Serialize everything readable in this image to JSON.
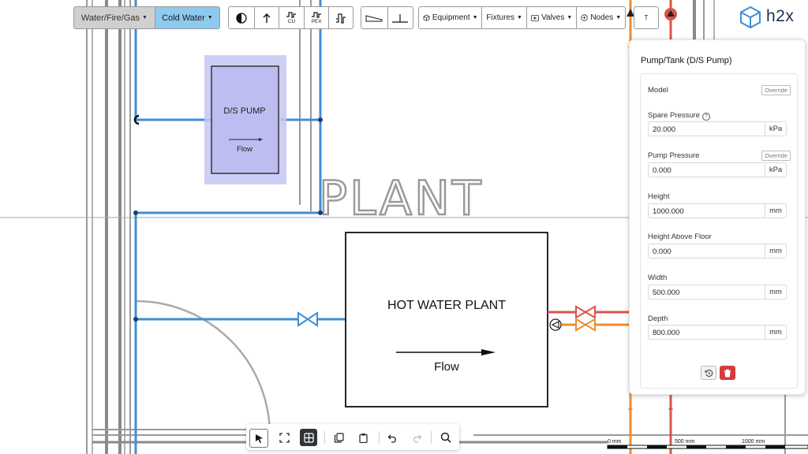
{
  "toolbar": {
    "system_label": "Water/Fire/Gas",
    "subsystem_label": "Cold Water",
    "material_cu": "CU",
    "material_pex": "PEX",
    "equipment_label": "Equipment",
    "fixtures_label": "Fixtures",
    "valves_label": "Valves",
    "nodes_label": "Nodes",
    "text_tool": "T"
  },
  "brand": {
    "name": "h2x"
  },
  "canvas": {
    "pump_label": "D/S PUMP",
    "pump_flow": "Flow",
    "plant_title": "PLANT",
    "hwp_title": "HOT WATER PLANT",
    "hwp_flow": "Flow"
  },
  "panel": {
    "title": "Pump/Tank (D/S Pump)",
    "fields": [
      {
        "label": "Model",
        "override": "Override"
      },
      {
        "label": "Spare Pressure",
        "value": "20.000",
        "unit": "kPa"
      },
      {
        "label": "Pump Pressure",
        "override": "Override",
        "value": "0.000",
        "unit": "kPa"
      },
      {
        "label": "Height",
        "value": "1000.000",
        "unit": "mm"
      },
      {
        "label": "Height Above Floor",
        "value": "0.000",
        "unit": "mm"
      },
      {
        "label": "Width",
        "value": "500.000",
        "unit": "mm"
      },
      {
        "label": "Depth",
        "value": "800.000",
        "unit": "mm"
      }
    ]
  },
  "scale": {
    "zero": "0 mm",
    "mid": "500 mm",
    "end": "1000 mm"
  },
  "colors": {
    "cold_water": "#3d8fd6",
    "hot_water": "#d9544a",
    "warm_water": "#ef8b2c",
    "pump_fill": "#c6c6f5",
    "accent": "#8ec9ee"
  }
}
